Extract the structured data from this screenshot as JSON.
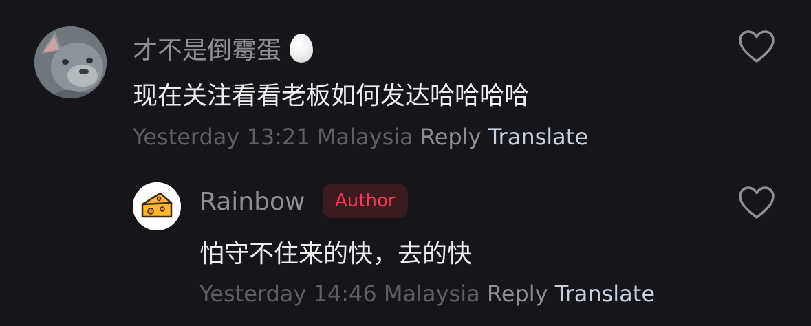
{
  "comments": [
    {
      "username": "才不是倒霉蛋",
      "username_icon": "egg-emoji-icon",
      "avatar": "french-bulldog-avatar",
      "text": "现在关注看看老板如何发达哈哈哈哈",
      "time": "Yesterday 13:21",
      "location": "Malaysia",
      "reply_label": "Reply",
      "translate_label": "Translate",
      "like_icon": "heart-outline-icon"
    },
    {
      "username": "Rainbow",
      "badge": "Author",
      "avatar": "cheese-avatar",
      "text": "怕守不住来的快，去的快",
      "time": "Yesterday 14:46",
      "location": "Malaysia",
      "reply_label": "Reply",
      "translate_label": "Translate",
      "like_icon": "heart-outline-icon"
    }
  ],
  "colors": {
    "background": "#161519",
    "username": "#8e8e93",
    "content": "#ededed",
    "meta": "#5e5e63",
    "translate": "#c7d0dd",
    "author_badge_bg": "#3b1a20",
    "author_badge_text": "#f23c55"
  }
}
